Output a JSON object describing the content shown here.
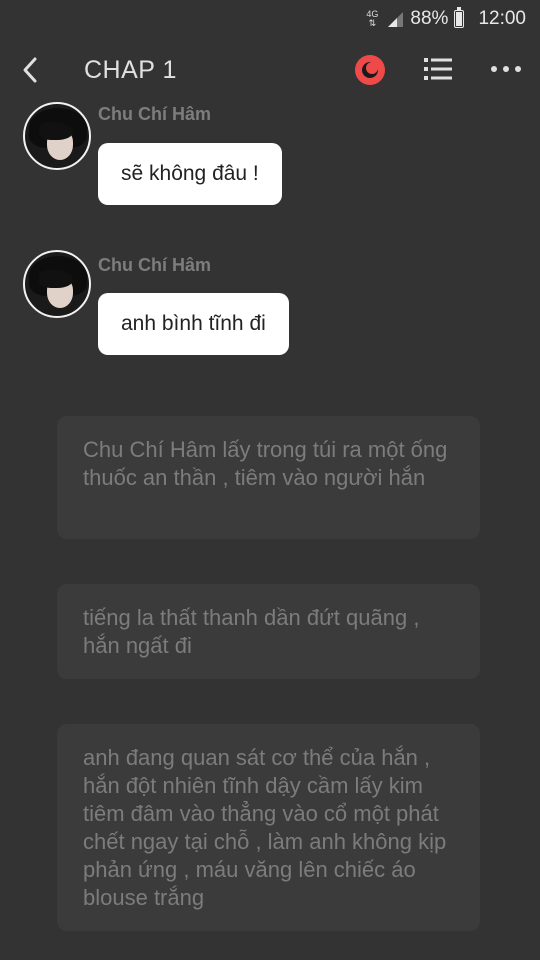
{
  "status_bar": {
    "network": "4G",
    "battery": "88%",
    "battery_level": 0.88,
    "time": "12:00"
  },
  "app_bar": {
    "back_icon": "chevron-left-icon",
    "title": "CHAP 1",
    "record_icon": "record-icon",
    "list_icon": "list-icon",
    "more_icon": "more-horizontal-icon",
    "record_color": "#ef4a4a"
  },
  "messages": [
    {
      "sender": "Chu Chí Hâm",
      "text": "sẽ không đâu !"
    },
    {
      "sender": "Chu Chí Hâm",
      "text": "anh bình tĩnh đi"
    }
  ],
  "narrations": [
    {
      "text": "Chu Chí Hâm lấy trong túi ra một ống thuốc an thần , tiêm vào người hắn"
    },
    {
      "text": "tiếng la thất thanh dần đứt quãng , hắn ngất đi"
    },
    {
      "text": "anh đang quan sát cơ thể của hắn , hắn đột nhiên tĩnh dậy cầm lấy kim tiêm đâm vào thẳng vào cổ một phát chết ngay tại chỗ , làm anh không kịp phản ứng , máu văng lên chiếc áo blouse trắng"
    }
  ]
}
